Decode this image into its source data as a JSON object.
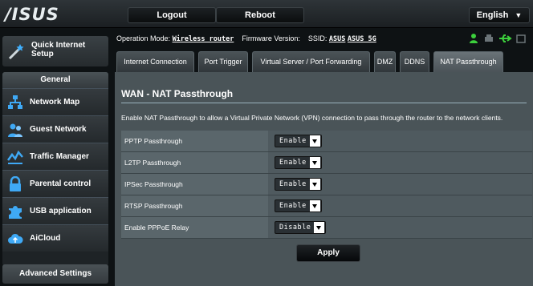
{
  "brand": {
    "logo_text": "/ISUS"
  },
  "topbar": {
    "logout_label": "Logout",
    "reboot_label": "Reboot",
    "language": "English"
  },
  "sidebar": {
    "quick_setup_label": "Quick Internet Setup",
    "general_header": "General",
    "items": [
      {
        "label": "Network Map",
        "icon": "network-map-icon"
      },
      {
        "label": "Guest Network",
        "icon": "guest-network-icon"
      },
      {
        "label": "Traffic Manager",
        "icon": "traffic-manager-icon"
      },
      {
        "label": "Parental control",
        "icon": "lock-icon"
      },
      {
        "label": "USB application",
        "icon": "puzzle-icon"
      },
      {
        "label": "AiCloud",
        "icon": "cloud-icon"
      }
    ],
    "advanced_label": "Advanced Settings"
  },
  "status": {
    "op_mode_label": "Operation Mode:",
    "op_mode_value": "Wireless router",
    "firmware_label": "Firmware Version:",
    "ssid_label": "SSID:",
    "ssid_1": "ASUS",
    "ssid_2": "ASUS_5G"
  },
  "tabs": [
    {
      "label": "Internet Connection"
    },
    {
      "label": "Port Trigger"
    },
    {
      "label": "Virtual Server / Port Forwarding"
    },
    {
      "label": "DMZ"
    },
    {
      "label": "DDNS"
    },
    {
      "label": "NAT Passthrough",
      "active": true
    }
  ],
  "main": {
    "title": "WAN - NAT Passthrough",
    "description": "Enable NAT Passthrough to allow a Virtual Private Network (VPN) connection to pass through the router to the network clients.",
    "rows": [
      {
        "label": "PPTP Passthrough",
        "value": "Enable"
      },
      {
        "label": "L2TP Passthrough",
        "value": "Enable"
      },
      {
        "label": "IPSec Passthrough",
        "value": "Enable"
      },
      {
        "label": "RTSP Passthrough",
        "value": "Enable"
      },
      {
        "label": "Enable PPPoE Relay",
        "value": "Disable"
      }
    ],
    "apply_label": "Apply"
  },
  "colors": {
    "accent_green": "#3ccf3c",
    "panel_bg": "#4a5458"
  }
}
